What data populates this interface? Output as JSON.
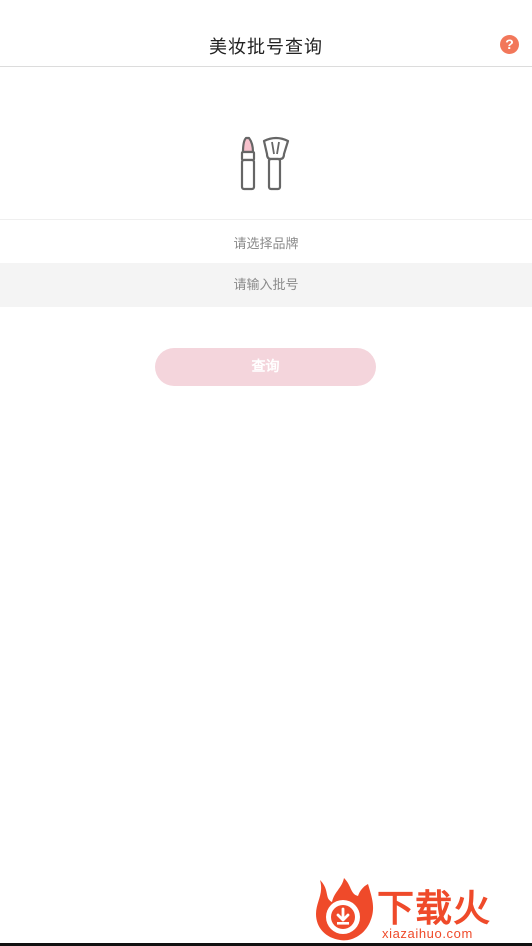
{
  "header": {
    "title": "美妆批号查询",
    "help_label": "?"
  },
  "form": {
    "brand_placeholder": "请选择品牌",
    "batch_placeholder": "请输入批号",
    "submit_label": "查询"
  },
  "watermark": {
    "text": "下载火",
    "domain": "xiazaihuo.com"
  },
  "colors": {
    "accent": "#f2775a",
    "button_disabled": "#f4d5dc",
    "lipstick_tip": "#f7c1cc",
    "watermark": "#ef4a2a"
  },
  "icons": [
    "help-icon",
    "cosmetics-icon",
    "flame-logo-icon"
  ]
}
